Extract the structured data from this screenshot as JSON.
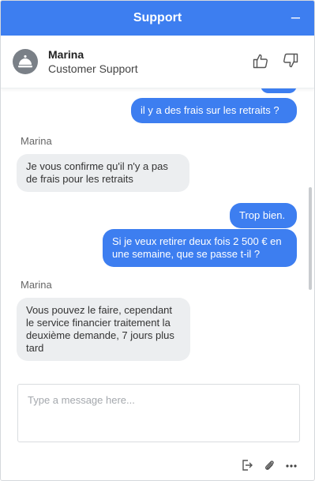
{
  "header": {
    "title": "Support",
    "minimize_label": "–"
  },
  "agent": {
    "name": "Marina",
    "role": "Customer Support"
  },
  "messages": [
    {
      "from": "user",
      "text": ""
    },
    {
      "from": "user",
      "text": "il y a des frais sur les retraits ?"
    },
    {
      "from": "agent",
      "sender": "Marina",
      "text": "Je vous confirme qu'il n'y a pas de frais pour les retraits"
    },
    {
      "from": "user",
      "text": "Trop bien."
    },
    {
      "from": "user",
      "text": "Si je veux retirer deux fois 2 500 € en une semaine, que se passe t-il ?"
    },
    {
      "from": "agent",
      "sender": "Marina",
      "text": "Vous pouvez le faire, cependant le service financier traitement la deuxième demande, 7 jours plus tard"
    }
  ],
  "composer": {
    "placeholder": "Type a message here..."
  },
  "colors": {
    "accent": "#3d7ef0",
    "agent_bubble": "#eceef0"
  },
  "icons": {
    "avatar": "bell-icon",
    "rate_up": "thumbs-up-icon",
    "rate_down": "thumbs-down-icon",
    "tools": [
      "exit-icon",
      "paperclip-icon",
      "more-icon"
    ]
  }
}
